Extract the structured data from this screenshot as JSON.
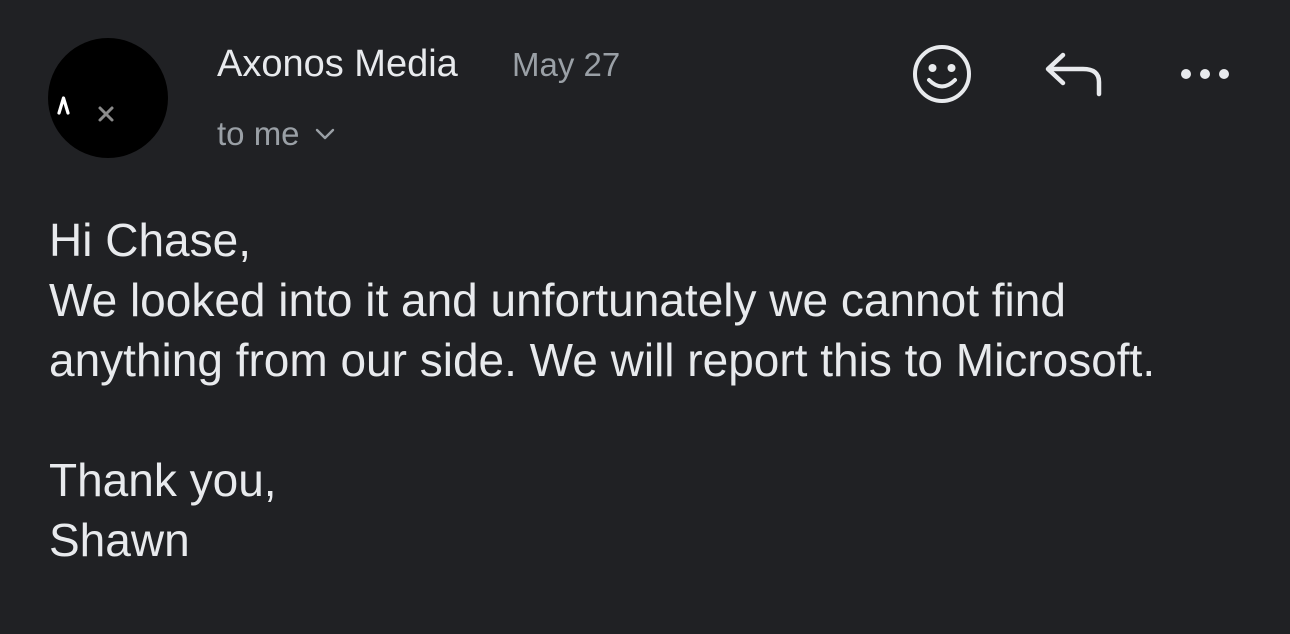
{
  "email": {
    "sender": {
      "name": "Axonos Media",
      "avatar_icon": "axonos-logo-icon"
    },
    "date": "May 27",
    "recipient_label": "to me",
    "actions": {
      "react_icon": "smiley-face-icon",
      "reply_icon": "reply-arrow-icon",
      "more_icon": "more-horizontal-icon"
    },
    "body": {
      "greeting": "Hi Chase,",
      "paragraph": "We looked into it and unfortunately we cannot find anything from our side. We will report this to Microsoft.",
      "closing": "Thank you,",
      "signature": "Shawn"
    }
  },
  "colors": {
    "background": "#202124",
    "primary_text": "#e8eaed",
    "secondary_text": "#9aa0a6",
    "avatar_bg": "#000000"
  }
}
